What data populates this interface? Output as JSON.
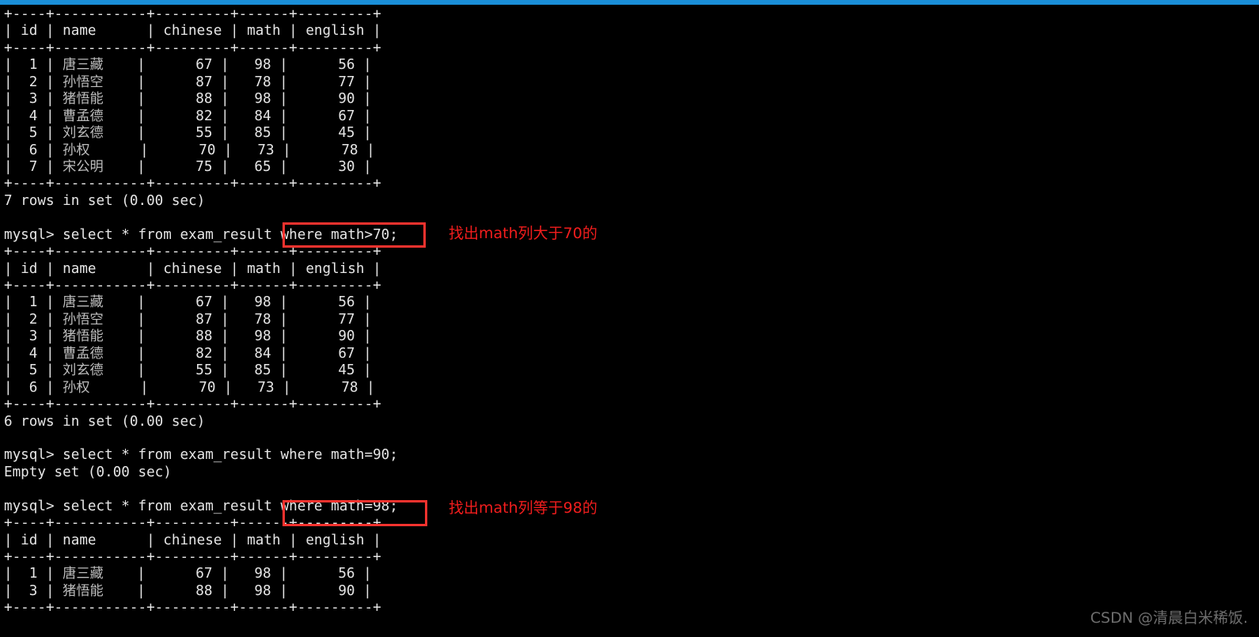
{
  "window": {
    "top_bar_color": "#1a8fd8",
    "background_color": "#000000",
    "foreground_color": "#e6e6e6"
  },
  "terminal": {
    "prompt": "mysql> ",
    "lines": [
      "+----+-----------+---------+------+---------+",
      "| id | name      | chinese | math | english |",
      "+----+-----------+---------+------+---------+",
      "|  1 | 唐三藏    |      67 |   98 |      56 |",
      "|  2 | 孙悟空    |      87 |   78 |      77 |",
      "|  3 | 猪悟能    |      88 |   98 |      90 |",
      "|  4 | 曹孟德    |      82 |   84 |      67 |",
      "|  5 | 刘玄德    |      55 |   85 |      45 |",
      "|  6 | 孙权      |      70 |   73 |      78 |",
      "|  7 | 宋公明    |      75 |   65 |      30 |",
      "+----+-----------+---------+------+---------+",
      "7 rows in set (0.00 sec)",
      "",
      "mysql> select * from exam_result where math>70;",
      "+----+-----------+---------+------+---------+",
      "| id | name      | chinese | math | english |",
      "+----+-----------+---------+------+---------+",
      "|  1 | 唐三藏    |      67 |   98 |      56 |",
      "|  2 | 孙悟空    |      87 |   78 |      77 |",
      "|  3 | 猪悟能    |      88 |   98 |      90 |",
      "|  4 | 曹孟德    |      82 |   84 |      67 |",
      "|  5 | 刘玄德    |      55 |   85 |      45 |",
      "|  6 | 孙权      |      70 |   73 |      78 |",
      "+----+-----------+---------+------+---------+",
      "6 rows in set (0.00 sec)",
      "",
      "mysql> select * from exam_result where math=90;",
      "Empty set (0.00 sec)",
      "",
      "mysql> select * from exam_result where math=98;",
      "+----+-----------+---------+------+---------+",
      "| id | name      | chinese | math | english |",
      "+----+-----------+---------+------+---------+",
      "|  1 | 唐三藏    |      67 |   98 |      56 |",
      "|  3 | 猪悟能    |      88 |   98 |      90 |",
      "+----+-----------+---------+------+---------+"
    ]
  },
  "queries": [
    {
      "full": "mysql> select * from exam_result where math>70;",
      "highlighted_fragment": "where math>70;",
      "result_count": "6 rows in set (0.00 sec)"
    },
    {
      "full": "mysql> select * from exam_result where math=90;",
      "highlighted_fragment": null,
      "result_count": "Empty set (0.00 sec)"
    },
    {
      "full": "mysql> select * from exam_result where math=98;",
      "highlighted_fragment": "where math=98;",
      "result_count": null
    }
  ],
  "result_table": {
    "columns": [
      "id",
      "name",
      "chinese",
      "math",
      "english"
    ],
    "all_rows": [
      {
        "id": "1",
        "name": "唐三藏",
        "chinese": "67",
        "math": "98",
        "english": "56"
      },
      {
        "id": "2",
        "name": "孙悟空",
        "chinese": "87",
        "math": "78",
        "english": "77"
      },
      {
        "id": "3",
        "name": "猪悟能",
        "chinese": "88",
        "math": "98",
        "english": "90"
      },
      {
        "id": "4",
        "name": "曹孟德",
        "chinese": "82",
        "math": "84",
        "english": "67"
      },
      {
        "id": "5",
        "name": "刘玄德",
        "chinese": "55",
        "math": "85",
        "english": "45"
      },
      {
        "id": "6",
        "name": "孙权",
        "chinese": "70",
        "math": "73",
        "english": "78"
      },
      {
        "id": "7",
        "name": "宋公明",
        "chinese": "75",
        "math": "65",
        "english": "30"
      }
    ]
  },
  "annotations": [
    {
      "text": "找出math列大于70的",
      "color": "#f21d1d"
    },
    {
      "text": "找出math列等于98的",
      "color": "#f21d1d"
    }
  ],
  "highlight_boxes": [
    {
      "label": "where math>70;",
      "color": "#f5322e"
    },
    {
      "label": "where math=98;",
      "color": "#f5322e"
    }
  ],
  "watermark": {
    "text": "CSDN @清晨白米稀饭."
  }
}
